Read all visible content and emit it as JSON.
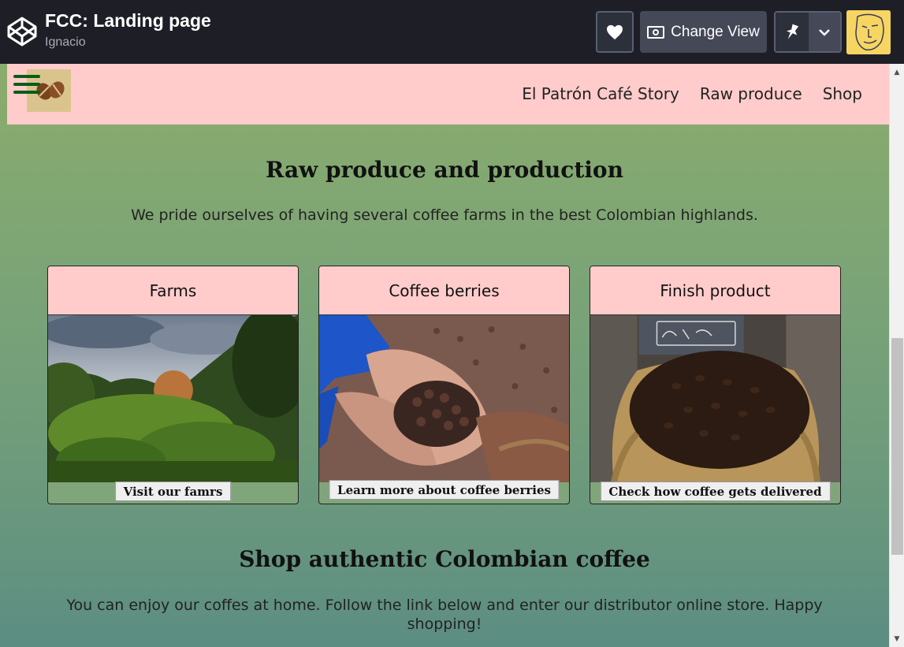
{
  "codepen": {
    "title": "FCC: Landing page",
    "author": "Ignacio",
    "change_view_label": "Change View",
    "icons": [
      "codepen-logo-icon",
      "heart-icon",
      "eye-icon",
      "pin-icon",
      "chevron-down-icon"
    ]
  },
  "site": {
    "nav": {
      "links": [
        "El Patrón Café Story",
        "Raw produce",
        "Shop"
      ]
    },
    "raw": {
      "title": "Raw produce and production",
      "text": "We pride ourselves of having several coffee farms in the best Colombian highlands."
    },
    "cards": [
      {
        "title": "Farms",
        "button": "Visit our famrs"
      },
      {
        "title": "Coffee berries",
        "button": "Learn more about coffee berries"
      },
      {
        "title": "Finish product",
        "button": "Check how coffee gets delivered"
      }
    ],
    "shop": {
      "title": "Shop authentic Colombian coffee",
      "text": "You can enjoy our coffes at home. Follow the link below and enter our distributor online store. Happy shopping!"
    }
  },
  "colors": {
    "navbar": "#ffcccb",
    "card_header": "#ffcccb",
    "header_bg": "#1e1f26",
    "hamburger": "#0a5c16"
  }
}
